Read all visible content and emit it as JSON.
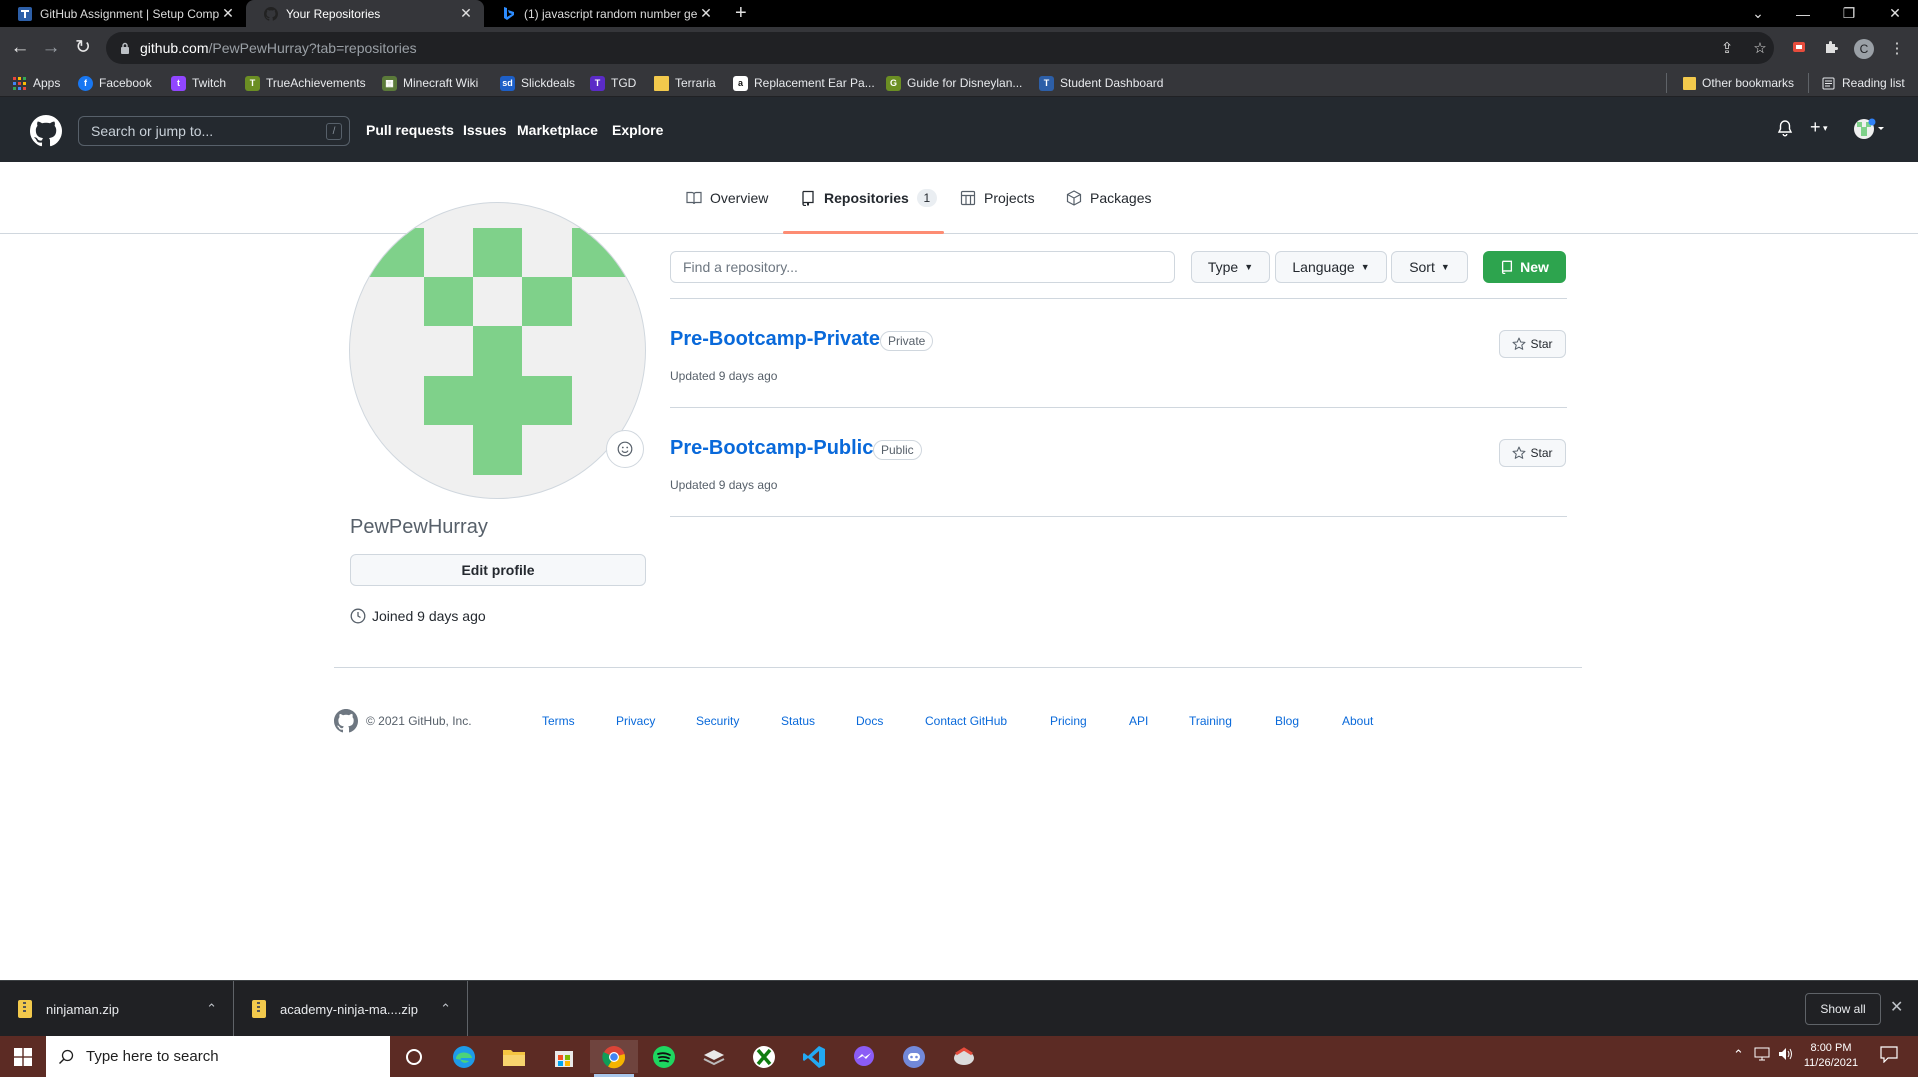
{
  "browser": {
    "tabs": [
      {
        "title": "GitHub Assignment | Setup Comp",
        "icon": "coding-dojo-icon",
        "active": false
      },
      {
        "title": "Your Repositories",
        "icon": "github-icon",
        "active": true
      },
      {
        "title": "(1) javascript random number ge",
        "icon": "bing-icon",
        "active": false
      }
    ],
    "new_tab": "+",
    "url_host": "github.com",
    "url_path": "/PewPewHurray?tab=repositories",
    "profile_initial": "C",
    "bookmarks": [
      {
        "label": "Apps",
        "icon": "apps-grid-icon",
        "color": "#e8453c"
      },
      {
        "label": "Facebook",
        "icon": "facebook-icon",
        "color": "#1877f2"
      },
      {
        "label": "Twitch",
        "icon": "twitch-icon",
        "color": "#9146ff"
      },
      {
        "label": "TrueAchievements",
        "icon": "trueachievements-icon",
        "color": "#6b8e23"
      },
      {
        "label": "Minecraft Wiki",
        "icon": "minecraft-icon",
        "color": "#5b7a3a"
      },
      {
        "label": "Slickdeals",
        "icon": "slickdeals-icon",
        "color": "#1d5fc7"
      },
      {
        "label": "TGD",
        "icon": "tgd-icon",
        "color": "#5b2bc7"
      },
      {
        "label": "Terraria",
        "icon": "folder-icon",
        "color": "#f2c94c"
      },
      {
        "label": "Replacement Ear Pa...",
        "icon": "amazon-icon",
        "color": "#ffffff"
      },
      {
        "label": "Guide for Disneylan...",
        "icon": "guide-icon",
        "color": "#6b8e23"
      },
      {
        "label": "Student Dashboard",
        "icon": "coding-dojo-icon",
        "color": "#2d5fa8"
      }
    ],
    "other_bookmarks": "Other bookmarks",
    "reading_list": "Reading list"
  },
  "github": {
    "search_placeholder": "Search or jump to...",
    "search_shortcut": "/",
    "nav": [
      "Pull requests",
      "Issues",
      "Marketplace",
      "Explore"
    ],
    "profile_tabs": [
      {
        "label": "Overview",
        "icon": "book-icon"
      },
      {
        "label": "Repositories",
        "icon": "repo-icon",
        "count": "1",
        "selected": true
      },
      {
        "label": "Projects",
        "icon": "project-icon"
      },
      {
        "label": "Packages",
        "icon": "package-icon"
      }
    ],
    "username": "PewPewHurray",
    "edit_profile": "Edit profile",
    "joined": "Joined 9 days ago",
    "find_placeholder": "Find a repository...",
    "filters": {
      "type": "Type",
      "language": "Language",
      "sort": "Sort"
    },
    "new_button": "New",
    "repos": [
      {
        "name": "Pre-Bootcamp-Private",
        "visibility": "Private",
        "updated": "Updated 9 days ago",
        "star": "Star"
      },
      {
        "name": "Pre-Bootcamp-Public",
        "visibility": "Public",
        "updated": "Updated 9 days ago",
        "star": "Star"
      }
    ],
    "footer": {
      "copyright": "© 2021 GitHub, Inc.",
      "links": [
        "Terms",
        "Privacy",
        "Security",
        "Status",
        "Docs",
        "Contact GitHub",
        "Pricing",
        "API",
        "Training",
        "Blog",
        "About"
      ]
    },
    "colors": {
      "header": "#24292f",
      "link": "#0969da",
      "new_button": "#2da44e",
      "tab_underline": "#fd8c73",
      "identicon": "#7fd18a"
    }
  },
  "downloads": {
    "items": [
      {
        "file": "ninjaman.zip"
      },
      {
        "file": "academy-ninja-ma....zip"
      }
    ],
    "show_all": "Show all"
  },
  "taskbar": {
    "search_placeholder": "Type here to search",
    "apps": [
      "cortana-icon",
      "edge-icon",
      "file-explorer-icon",
      "store-icon",
      "chrome-icon",
      "spotify-icon",
      "ssh-stack-icon",
      "xbox-icon",
      "vscode-icon",
      "messenger-icon",
      "discord-icon",
      "jetbrains-icon"
    ],
    "time": "8:00 PM",
    "date": "11/26/2021"
  }
}
